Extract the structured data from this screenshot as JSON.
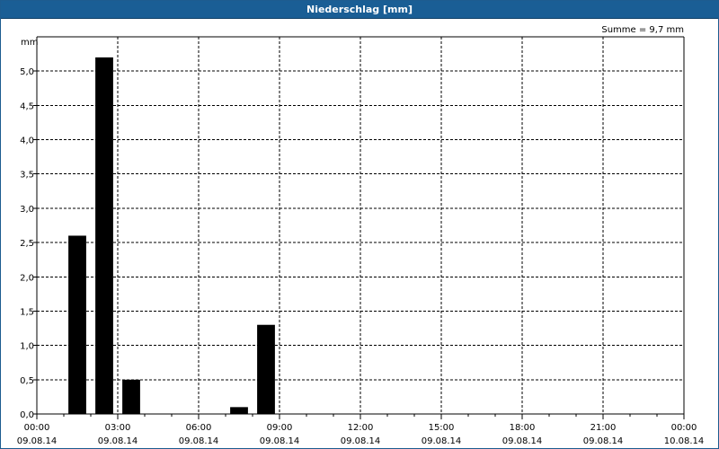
{
  "window": {
    "title": "Niederschlag [mm]"
  },
  "chart_data": {
    "type": "bar",
    "title": "Niederschlag [mm]",
    "ylabel": "mm",
    "summary": "Summe = 9,7 mm",
    "x_unit": "hours",
    "xlim": [
      0,
      24
    ],
    "ylim": [
      0,
      5.5
    ],
    "grid": true,
    "bar_color": "#000000",
    "y_ticks": [
      {
        "value": 0,
        "label": "0,0"
      },
      {
        "value": 0.5,
        "label": "0,5"
      },
      {
        "value": 1.0,
        "label": "1,0"
      },
      {
        "value": 1.5,
        "label": "1,5"
      },
      {
        "value": 2.0,
        "label": "2,0"
      },
      {
        "value": 2.5,
        "label": "2,5"
      },
      {
        "value": 3.0,
        "label": "3,0"
      },
      {
        "value": 3.5,
        "label": "3,5"
      },
      {
        "value": 4.0,
        "label": "4,0"
      },
      {
        "value": 4.5,
        "label": "4,5"
      },
      {
        "value": 5.0,
        "label": "5,0"
      }
    ],
    "x_ticks": [
      {
        "value": 0,
        "time": "00:00",
        "date": "09.08.14"
      },
      {
        "value": 3,
        "time": "03:00",
        "date": "09.08.14"
      },
      {
        "value": 6,
        "time": "06:00",
        "date": "09.08.14"
      },
      {
        "value": 9,
        "time": "09:00",
        "date": "09.08.14"
      },
      {
        "value": 12,
        "time": "12:00",
        "date": "09.08.14"
      },
      {
        "value": 15,
        "time": "15:00",
        "date": "09.08.14"
      },
      {
        "value": 18,
        "time": "18:00",
        "date": "09.08.14"
      },
      {
        "value": 21,
        "time": "21:00",
        "date": "09.08.14"
      },
      {
        "value": 24,
        "time": "00:00",
        "date": "10.08.14"
      }
    ],
    "bars": [
      {
        "hour_start": 1,
        "value": 2.6
      },
      {
        "hour_start": 2,
        "value": 5.2
      },
      {
        "hour_start": 3,
        "value": 0.5
      },
      {
        "hour_start": 7,
        "value": 0.1
      },
      {
        "hour_start": 8,
        "value": 1.3
      }
    ]
  }
}
